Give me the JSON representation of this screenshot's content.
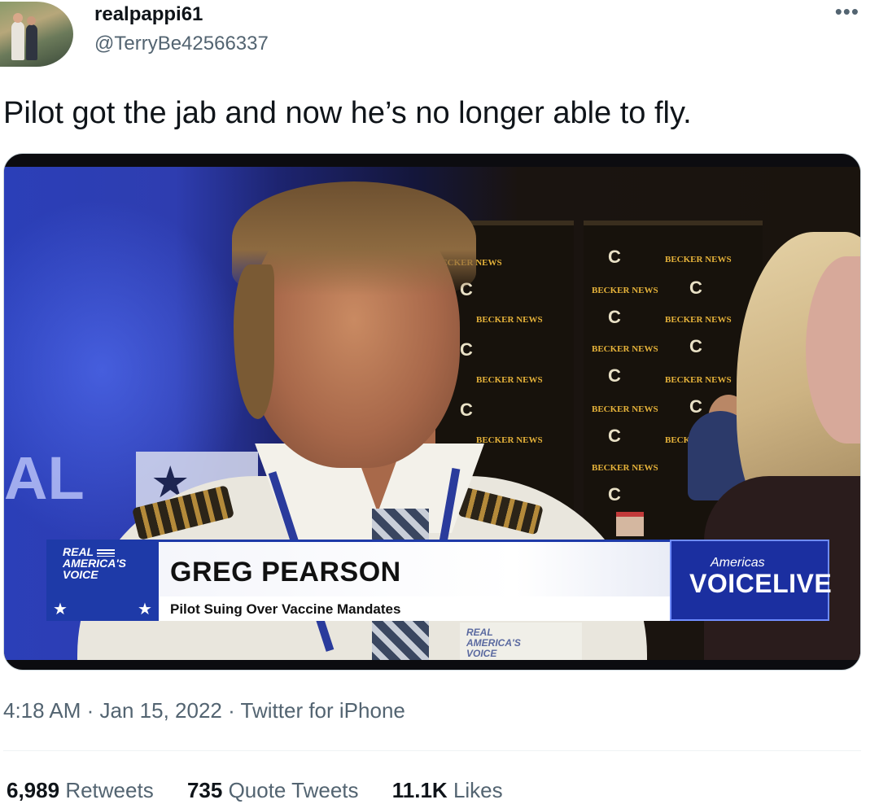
{
  "user": {
    "display_name": "realpappi61",
    "handle": "@TerryBe42566337"
  },
  "more_icon": "more-horizontal-icon",
  "tweet": {
    "text": "Pilot got the jab and now he’s no longer able to fly."
  },
  "video": {
    "lower_third": {
      "logo_line1": "REAL",
      "logo_line2": "AMERICA'S",
      "logo_line3": "VOICE",
      "name": "GREG PEARSON",
      "subtitle": "Pilot Suing Over Vaccine Mandates",
      "brand_small": "Americas",
      "brand_big": "VOICELIVE"
    },
    "background_banner_text": "BECKER NEWS",
    "mic_flag_line1": "REAL",
    "mic_flag_line2": "AMERICA'S",
    "mic_flag_line3": "VOICE",
    "bg_letters": "AL"
  },
  "meta": {
    "time": "4:18 AM",
    "date": "Jan 15, 2022",
    "source": "Twitter for iPhone"
  },
  "stats": {
    "retweets_count": "6,989",
    "retweets_label": "Retweets",
    "quotes_count": "735",
    "quotes_label": "Quote Tweets",
    "likes_count": "11.1K",
    "likes_label": "Likes"
  },
  "colors": {
    "accent_blue": "#1e3aa8",
    "secondary_text": "#536471",
    "primary_text": "#0f1419"
  }
}
